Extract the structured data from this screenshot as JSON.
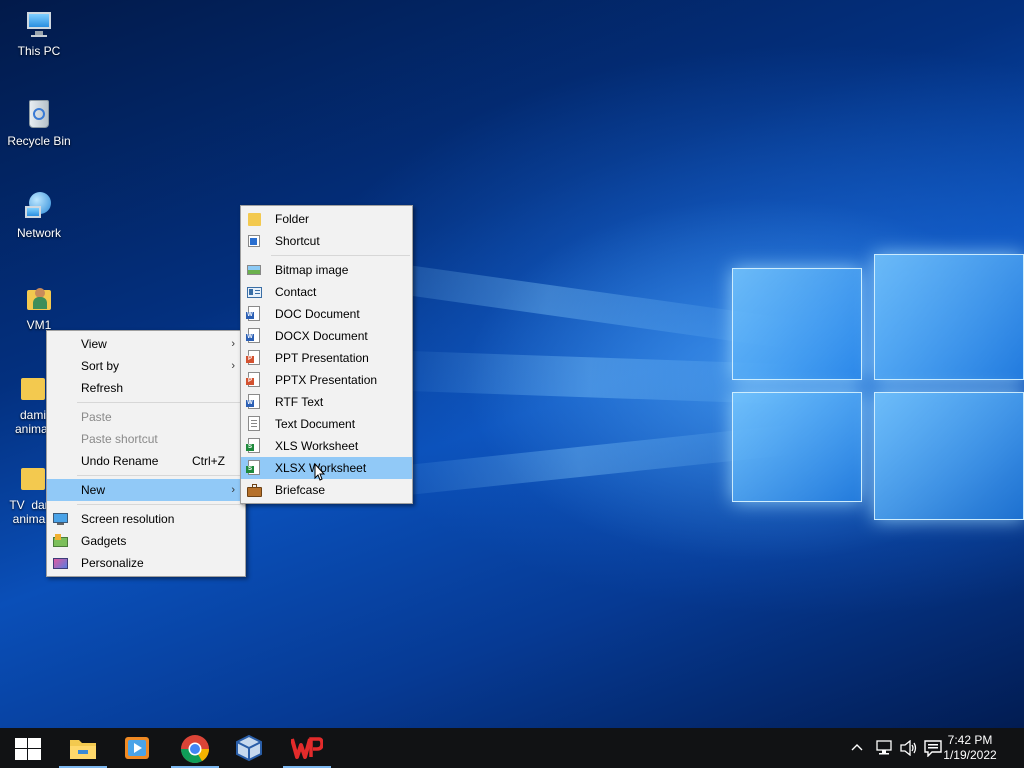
{
  "desktop": {
    "icons": [
      {
        "label": "This PC",
        "icon": "this-pc-icon"
      },
      {
        "label": "Recycle Bin",
        "icon": "recycle-bin-icon"
      },
      {
        "label": "Network",
        "icon": "network-icon"
      },
      {
        "label": "VM1",
        "icon": "user-folder-icon"
      },
      {
        "label": "dami animat",
        "line1": "dami",
        "line2": "animat",
        "icon": "folder-icon"
      },
      {
        "label": "TV dar anima",
        "line1": "TV  dar",
        "line2": "anima",
        "icon": "folder-icon"
      }
    ]
  },
  "context_menu": {
    "items": [
      {
        "label": "View",
        "submenu": true
      },
      {
        "label": "Sort by",
        "submenu": true
      },
      {
        "label": "Refresh"
      },
      {
        "label": "Paste",
        "disabled": true
      },
      {
        "label": "Paste shortcut",
        "disabled": true
      },
      {
        "label": "Undo Rename",
        "shortcut": "Ctrl+Z"
      },
      {
        "label": "New",
        "submenu": true,
        "highlighted": true
      },
      {
        "label": "Screen resolution",
        "icon": "monitor-icon"
      },
      {
        "label": "Gadgets",
        "icon": "gadgets-icon"
      },
      {
        "label": "Personalize",
        "icon": "personalize-icon"
      }
    ]
  },
  "new_submenu": {
    "items": [
      {
        "label": "Folder",
        "icon": "folder-icon"
      },
      {
        "label": "Shortcut",
        "icon": "shortcut-icon"
      },
      {
        "label": "Bitmap image",
        "icon": "bitmap-icon"
      },
      {
        "label": "Contact",
        "icon": "contact-icon"
      },
      {
        "label": "DOC Document",
        "icon": "doc-icon",
        "tag": "W",
        "color": "#2b5fb4"
      },
      {
        "label": "DOCX Document",
        "icon": "docx-icon",
        "tag": "W",
        "color": "#2b5fb4"
      },
      {
        "label": "PPT Presentation",
        "icon": "ppt-icon",
        "tag": "P",
        "color": "#d35230"
      },
      {
        "label": "PPTX Presentation",
        "icon": "pptx-icon",
        "tag": "P",
        "color": "#d35230"
      },
      {
        "label": "RTF Text",
        "icon": "rtf-icon",
        "tag": "W",
        "color": "#2b5fb4"
      },
      {
        "label": "Text Document",
        "icon": "text-document-icon"
      },
      {
        "label": "XLS Worksheet",
        "icon": "xls-icon",
        "tag": "S",
        "color": "#1e8a3c"
      },
      {
        "label": "XLSX Worksheet",
        "icon": "xlsx-icon",
        "tag": "S",
        "color": "#1e8a3c",
        "highlighted": true
      },
      {
        "label": "Briefcase",
        "icon": "briefcase-icon"
      }
    ]
  },
  "taskbar": {
    "apps": [
      {
        "name": "start-button",
        "icon": "windows-logo-icon"
      },
      {
        "name": "file-explorer",
        "icon": "file-explorer-icon",
        "active": true
      },
      {
        "name": "media-player",
        "icon": "media-player-icon"
      },
      {
        "name": "chrome",
        "icon": "chrome-icon",
        "active": true
      },
      {
        "name": "virtualbox",
        "icon": "virtualbox-icon"
      },
      {
        "name": "wps-office",
        "icon": "wps-office-icon",
        "active": true
      }
    ],
    "clock": {
      "time": "7:42 PM",
      "date": "1/19/2022"
    }
  },
  "colors": {
    "menu_bg": "#f2f2f2",
    "highlight": "#91c9f7",
    "taskbar_bg": "#111214",
    "taskbar_accent": "#7cb7f0"
  }
}
